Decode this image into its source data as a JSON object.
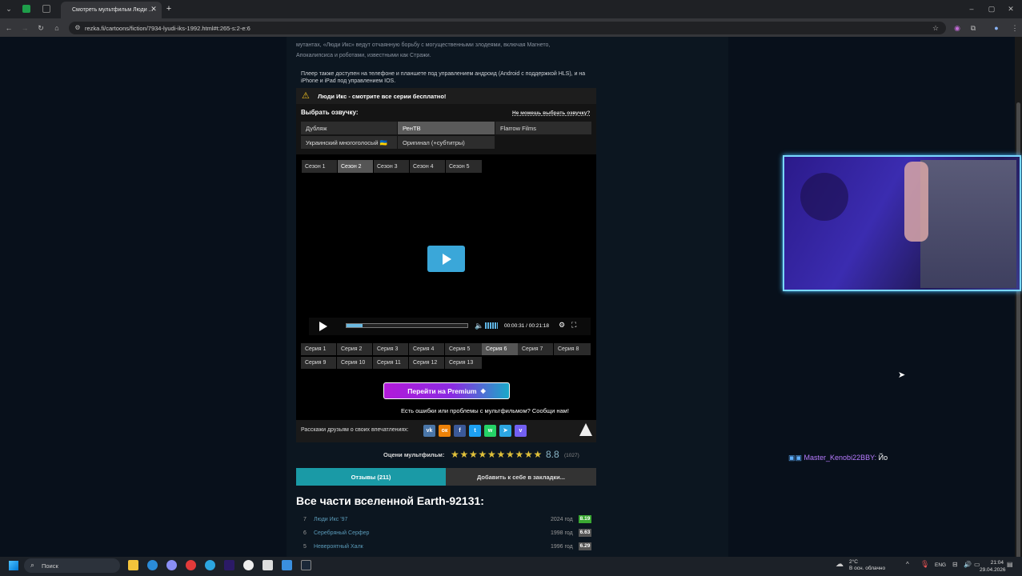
{
  "browser": {
    "tab_title": "Смотреть мультфильм Люди ...",
    "url": "rezka.fi/cartoons/fiction/7934-lyudi-iks-1992.html#t:265-s:2-e:6"
  },
  "description": {
    "line1": "мутантах, «Люди Икс» ведут отчаянную борьбу с могущественными злодеями, включая Магнето,",
    "line2": "Апокалипсиса и роботами, известными как Стражи.",
    "player_note": "Плеер также доступен на телефоне и планшете под управлением андроид (Android с поддержкой HLS), и на iPhone и iPad под управлением IOS."
  },
  "notice": "Люди Икс - смотрите все серии бесплатно!",
  "voice": {
    "label": "Выбрать озвучку:",
    "help_link": "Не можешь выбрать озвучку?",
    "options": [
      "Дубляж",
      "РенТВ",
      "Flarrow Films",
      "Украинский многоголосый 🇺🇦",
      "Оригинал (+субтитры)"
    ],
    "selected": "РенТВ"
  },
  "seasons": [
    "Сезон 1",
    "Сезон 2",
    "Сезон 3",
    "Сезон 4",
    "Сезон 5"
  ],
  "selected_season": "Сезон 2",
  "player": {
    "time": "00:00:31 / 00:21:18",
    "progress": 0.02
  },
  "episodes": [
    "Серия 1",
    "Серия 2",
    "Серия 3",
    "Серия 4",
    "Серия 5",
    "Серия 6",
    "Серия 7",
    "Серия 8",
    "Серия 9",
    "Серия 10",
    "Серия 11",
    "Серия 12",
    "Серия 13"
  ],
  "selected_episode": "Серия 6",
  "premium_label": "Перейти на Premium",
  "report_text": "Есть ошибки или проблемы с мультфильмом? Сообщи нам!",
  "share": {
    "label": "Расскажи друзьям о своих впечатлениях:",
    "networks": [
      {
        "name": "vk",
        "glyph": "vk",
        "color": "#4a76a8"
      },
      {
        "name": "ok",
        "glyph": "ок",
        "color": "#ee8208"
      },
      {
        "name": "facebook",
        "glyph": "f",
        "color": "#3b5998"
      },
      {
        "name": "twitter",
        "glyph": "t",
        "color": "#1da1f2"
      },
      {
        "name": "whatsapp",
        "glyph": "w",
        "color": "#25d366"
      },
      {
        "name": "telegram",
        "glyph": "➤",
        "color": "#2ca5e0"
      },
      {
        "name": "viber",
        "glyph": "v",
        "color": "#7360f2"
      }
    ]
  },
  "rating": {
    "label": "Оцени мультфильм:",
    "value": "8.8",
    "count": "(1027)",
    "stars": 10
  },
  "tabs": {
    "reviews": "Отзывы (211)",
    "bookmark": "Добавить к себе в закладки..."
  },
  "universe": {
    "title": "Все части вселенной Earth-92131:",
    "items": [
      {
        "num": "7",
        "name": "Люди Икс '97",
        "year": "2024 год",
        "score": "8.19",
        "color": "#3aa832"
      },
      {
        "num": "6",
        "name": "Серебряный Серфер",
        "year": "1998 год",
        "score": "6.63",
        "color": "#555"
      },
      {
        "num": "5",
        "name": "Невероятный Халк",
        "year": "1996 год",
        "score": "6.29",
        "color": "#555"
      }
    ]
  },
  "chat": {
    "user": "Master_Kenobi22BBY:",
    "message": "Йо"
  },
  "taskbar": {
    "search": "Поиск",
    "weather_temp": "2°C",
    "weather_desc": "В осн. облачно",
    "lang": "ENG",
    "time": "21:04",
    "date": "29.04.2026"
  }
}
